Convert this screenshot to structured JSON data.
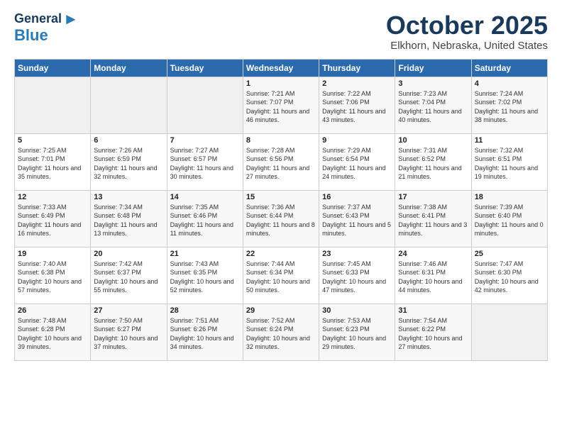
{
  "header": {
    "logo_line1": "General",
    "logo_line2": "Blue",
    "month": "October 2025",
    "location": "Elkhorn, Nebraska, United States"
  },
  "weekdays": [
    "Sunday",
    "Monday",
    "Tuesday",
    "Wednesday",
    "Thursday",
    "Friday",
    "Saturday"
  ],
  "weeks": [
    [
      {
        "day": "",
        "sunrise": "",
        "sunset": "",
        "daylight": ""
      },
      {
        "day": "",
        "sunrise": "",
        "sunset": "",
        "daylight": ""
      },
      {
        "day": "",
        "sunrise": "",
        "sunset": "",
        "daylight": ""
      },
      {
        "day": "1",
        "sunrise": "Sunrise: 7:21 AM",
        "sunset": "Sunset: 7:07 PM",
        "daylight": "Daylight: 11 hours and 46 minutes."
      },
      {
        "day": "2",
        "sunrise": "Sunrise: 7:22 AM",
        "sunset": "Sunset: 7:06 PM",
        "daylight": "Daylight: 11 hours and 43 minutes."
      },
      {
        "day": "3",
        "sunrise": "Sunrise: 7:23 AM",
        "sunset": "Sunset: 7:04 PM",
        "daylight": "Daylight: 11 hours and 40 minutes."
      },
      {
        "day": "4",
        "sunrise": "Sunrise: 7:24 AM",
        "sunset": "Sunset: 7:02 PM",
        "daylight": "Daylight: 11 hours and 38 minutes."
      }
    ],
    [
      {
        "day": "5",
        "sunrise": "Sunrise: 7:25 AM",
        "sunset": "Sunset: 7:01 PM",
        "daylight": "Daylight: 11 hours and 35 minutes."
      },
      {
        "day": "6",
        "sunrise": "Sunrise: 7:26 AM",
        "sunset": "Sunset: 6:59 PM",
        "daylight": "Daylight: 11 hours and 32 minutes."
      },
      {
        "day": "7",
        "sunrise": "Sunrise: 7:27 AM",
        "sunset": "Sunset: 6:57 PM",
        "daylight": "Daylight: 11 hours and 30 minutes."
      },
      {
        "day": "8",
        "sunrise": "Sunrise: 7:28 AM",
        "sunset": "Sunset: 6:56 PM",
        "daylight": "Daylight: 11 hours and 27 minutes."
      },
      {
        "day": "9",
        "sunrise": "Sunrise: 7:29 AM",
        "sunset": "Sunset: 6:54 PM",
        "daylight": "Daylight: 11 hours and 24 minutes."
      },
      {
        "day": "10",
        "sunrise": "Sunrise: 7:31 AM",
        "sunset": "Sunset: 6:52 PM",
        "daylight": "Daylight: 11 hours and 21 minutes."
      },
      {
        "day": "11",
        "sunrise": "Sunrise: 7:32 AM",
        "sunset": "Sunset: 6:51 PM",
        "daylight": "Daylight: 11 hours and 19 minutes."
      }
    ],
    [
      {
        "day": "12",
        "sunrise": "Sunrise: 7:33 AM",
        "sunset": "Sunset: 6:49 PM",
        "daylight": "Daylight: 11 hours and 16 minutes."
      },
      {
        "day": "13",
        "sunrise": "Sunrise: 7:34 AM",
        "sunset": "Sunset: 6:48 PM",
        "daylight": "Daylight: 11 hours and 13 minutes."
      },
      {
        "day": "14",
        "sunrise": "Sunrise: 7:35 AM",
        "sunset": "Sunset: 6:46 PM",
        "daylight": "Daylight: 11 hours and 11 minutes."
      },
      {
        "day": "15",
        "sunrise": "Sunrise: 7:36 AM",
        "sunset": "Sunset: 6:44 PM",
        "daylight": "Daylight: 11 hours and 8 minutes."
      },
      {
        "day": "16",
        "sunrise": "Sunrise: 7:37 AM",
        "sunset": "Sunset: 6:43 PM",
        "daylight": "Daylight: 11 hours and 5 minutes."
      },
      {
        "day": "17",
        "sunrise": "Sunrise: 7:38 AM",
        "sunset": "Sunset: 6:41 PM",
        "daylight": "Daylight: 11 hours and 3 minutes."
      },
      {
        "day": "18",
        "sunrise": "Sunrise: 7:39 AM",
        "sunset": "Sunset: 6:40 PM",
        "daylight": "Daylight: 11 hours and 0 minutes."
      }
    ],
    [
      {
        "day": "19",
        "sunrise": "Sunrise: 7:40 AM",
        "sunset": "Sunset: 6:38 PM",
        "daylight": "Daylight: 10 hours and 57 minutes."
      },
      {
        "day": "20",
        "sunrise": "Sunrise: 7:42 AM",
        "sunset": "Sunset: 6:37 PM",
        "daylight": "Daylight: 10 hours and 55 minutes."
      },
      {
        "day": "21",
        "sunrise": "Sunrise: 7:43 AM",
        "sunset": "Sunset: 6:35 PM",
        "daylight": "Daylight: 10 hours and 52 minutes."
      },
      {
        "day": "22",
        "sunrise": "Sunrise: 7:44 AM",
        "sunset": "Sunset: 6:34 PM",
        "daylight": "Daylight: 10 hours and 50 minutes."
      },
      {
        "day": "23",
        "sunrise": "Sunrise: 7:45 AM",
        "sunset": "Sunset: 6:33 PM",
        "daylight": "Daylight: 10 hours and 47 minutes."
      },
      {
        "day": "24",
        "sunrise": "Sunrise: 7:46 AM",
        "sunset": "Sunset: 6:31 PM",
        "daylight": "Daylight: 10 hours and 44 minutes."
      },
      {
        "day": "25",
        "sunrise": "Sunrise: 7:47 AM",
        "sunset": "Sunset: 6:30 PM",
        "daylight": "Daylight: 10 hours and 42 minutes."
      }
    ],
    [
      {
        "day": "26",
        "sunrise": "Sunrise: 7:48 AM",
        "sunset": "Sunset: 6:28 PM",
        "daylight": "Daylight: 10 hours and 39 minutes."
      },
      {
        "day": "27",
        "sunrise": "Sunrise: 7:50 AM",
        "sunset": "Sunset: 6:27 PM",
        "daylight": "Daylight: 10 hours and 37 minutes."
      },
      {
        "day": "28",
        "sunrise": "Sunrise: 7:51 AM",
        "sunset": "Sunset: 6:26 PM",
        "daylight": "Daylight: 10 hours and 34 minutes."
      },
      {
        "day": "29",
        "sunrise": "Sunrise: 7:52 AM",
        "sunset": "Sunset: 6:24 PM",
        "daylight": "Daylight: 10 hours and 32 minutes."
      },
      {
        "day": "30",
        "sunrise": "Sunrise: 7:53 AM",
        "sunset": "Sunset: 6:23 PM",
        "daylight": "Daylight: 10 hours and 29 minutes."
      },
      {
        "day": "31",
        "sunrise": "Sunrise: 7:54 AM",
        "sunset": "Sunset: 6:22 PM",
        "daylight": "Daylight: 10 hours and 27 minutes."
      },
      {
        "day": "",
        "sunrise": "",
        "sunset": "",
        "daylight": ""
      }
    ]
  ]
}
